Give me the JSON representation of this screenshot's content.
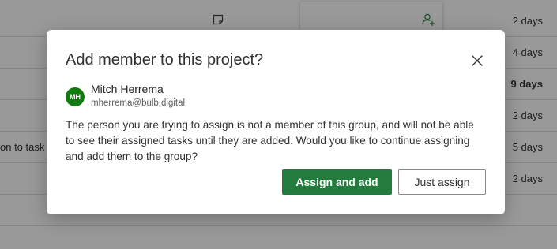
{
  "background": {
    "rows": [
      {
        "days": "2 days",
        "bold": false,
        "left_text": ""
      },
      {
        "days": "4 days",
        "bold": false,
        "left_text": ""
      },
      {
        "days": "9 days",
        "bold": true,
        "left_text": ""
      },
      {
        "days": "2 days",
        "bold": false,
        "left_text": ""
      },
      {
        "days": "5 days",
        "bold": false,
        "left_text": "on to task"
      },
      {
        "days": "2 days",
        "bold": false,
        "left_text": ""
      }
    ],
    "icons": {
      "note": "note-icon",
      "assign_user": "add-user-icon"
    }
  },
  "dialog": {
    "title": "Add member to this project?",
    "close_icon": "close-icon",
    "user": {
      "initials": "MH",
      "name": "Mitch Herrema",
      "email": "mherrema@bulb.digital",
      "avatar_color": "#107c10"
    },
    "message": "The person you are trying to assign is not a member of this group, and will not be able to see their assigned tasks until they are added. Would you like to continue assigning and add them to the group?",
    "primary_button": "Assign and add",
    "secondary_button": "Just assign"
  },
  "colors": {
    "primary": "#237b3e",
    "overlay": "rgba(0,0,0,0.40)"
  }
}
